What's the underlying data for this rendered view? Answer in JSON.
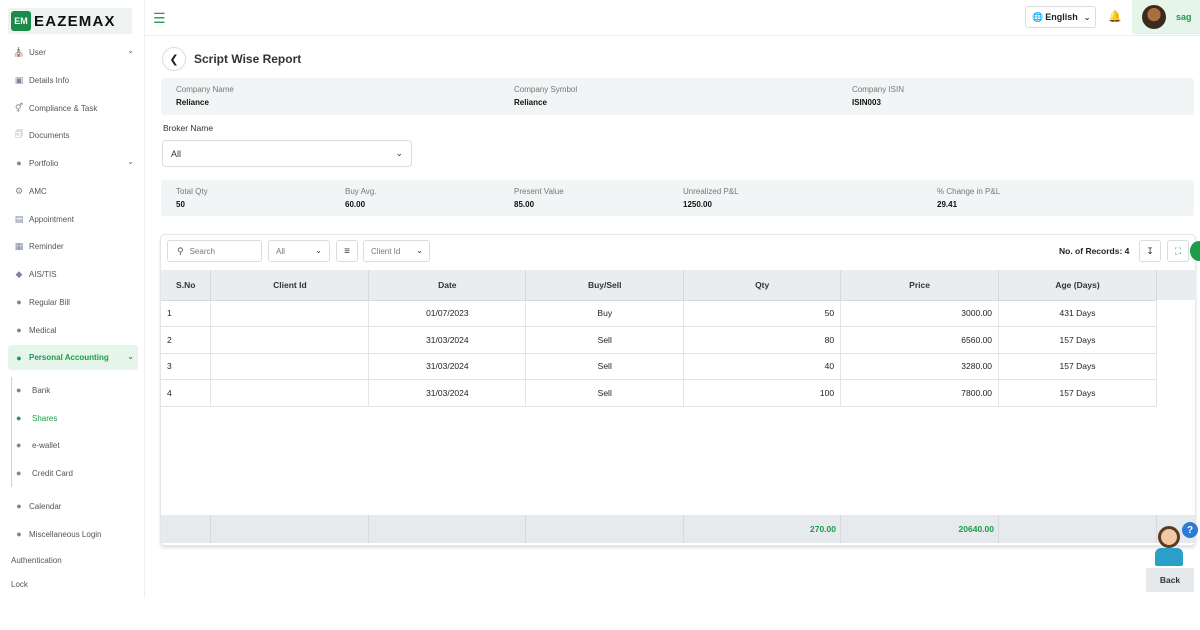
{
  "brand": {
    "logo_mark": "EM",
    "name": "EAZEMAX"
  },
  "topbar": {
    "menu_icon": "hamburger-icon",
    "language": "English",
    "user_name": "sag"
  },
  "sidebar": {
    "items": [
      {
        "label": "User",
        "icon": "user-home-icon",
        "has_chevron": true
      },
      {
        "label": "Details Info",
        "icon": "id-card-icon"
      },
      {
        "label": "Compliance & Task",
        "icon": "gender-icon"
      },
      {
        "label": "Documents",
        "icon": "documents-icon"
      },
      {
        "label": "Portfolio",
        "icon": "user-icon",
        "has_chevron": true
      },
      {
        "label": "AMC",
        "icon": "cog-icon"
      },
      {
        "label": "Appointment",
        "icon": "file-icon"
      },
      {
        "label": "Reminder",
        "icon": "reminder-icon"
      },
      {
        "label": "AIS/TIS",
        "icon": "tag-icon"
      },
      {
        "label": "Regular Bill",
        "icon": "user-check-icon"
      },
      {
        "label": "Medical",
        "icon": "user-check-icon"
      },
      {
        "label": "Personal Accounting",
        "icon": "user-check-icon",
        "has_chevron": true,
        "active": true
      }
    ],
    "sub_items": [
      {
        "label": "Bank"
      },
      {
        "label": "Shares",
        "active": true
      },
      {
        "label": "e-wallet"
      },
      {
        "label": "Credit Card"
      }
    ],
    "bottom_items": [
      {
        "label": "Calendar"
      },
      {
        "label": "Miscellaneous Login"
      }
    ],
    "plain_items": [
      "Authentication",
      "Lock"
    ]
  },
  "page": {
    "title": "Script Wise Report"
  },
  "company": {
    "name_label": "Company Name",
    "name": "Reliance",
    "symbol_label": "Company Symbol",
    "symbol": "Reliance",
    "isin_label": "Company ISIN",
    "isin": "ISIN003"
  },
  "broker": {
    "label": "Broker Name",
    "value": "All"
  },
  "summary": {
    "total_qty_label": "Total Qty",
    "total_qty": "50",
    "buy_avg_label": "Buy Avg.",
    "buy_avg": "60.00",
    "present_value_label": "Present Value",
    "present_value": "85.00",
    "unrealized_label": "Unrealized P&L",
    "unrealized": "1250.00",
    "change_label": "% Change in P&L",
    "change": "29.41"
  },
  "toolbar": {
    "search_placeholder": "Search",
    "all_option": "All",
    "client_id_option": "Client Id",
    "records_text": "No. of Records: 4"
  },
  "table": {
    "headers": [
      "S.No",
      "Client Id",
      "Date",
      "Buy/Sell",
      "Qty",
      "Price",
      "Age (Days)"
    ],
    "rows": [
      {
        "sno": "1",
        "client_id": "",
        "date": "01/07/2023",
        "type": "Buy",
        "qty": "50",
        "price": "3000.00",
        "age": "431 Days"
      },
      {
        "sno": "2",
        "client_id": "",
        "date": "31/03/2024",
        "type": "Sell",
        "qty": "80",
        "price": "6560.00",
        "age": "157 Days"
      },
      {
        "sno": "3",
        "client_id": "",
        "date": "31/03/2024",
        "type": "Sell",
        "qty": "40",
        "price": "3280.00",
        "age": "157 Days"
      },
      {
        "sno": "4",
        "client_id": "",
        "date": "31/03/2024",
        "type": "Sell",
        "qty": "100",
        "price": "7800.00",
        "age": "157 Days"
      }
    ],
    "footer": {
      "qty_total": "270.00",
      "price_total": "20640.00"
    }
  },
  "helper": {
    "back_label": "Back",
    "question": "?"
  },
  "colors": {
    "accent": "#1e9b4b",
    "header_bg": "#eaedef",
    "strip_bg": "#f2f5f6"
  }
}
